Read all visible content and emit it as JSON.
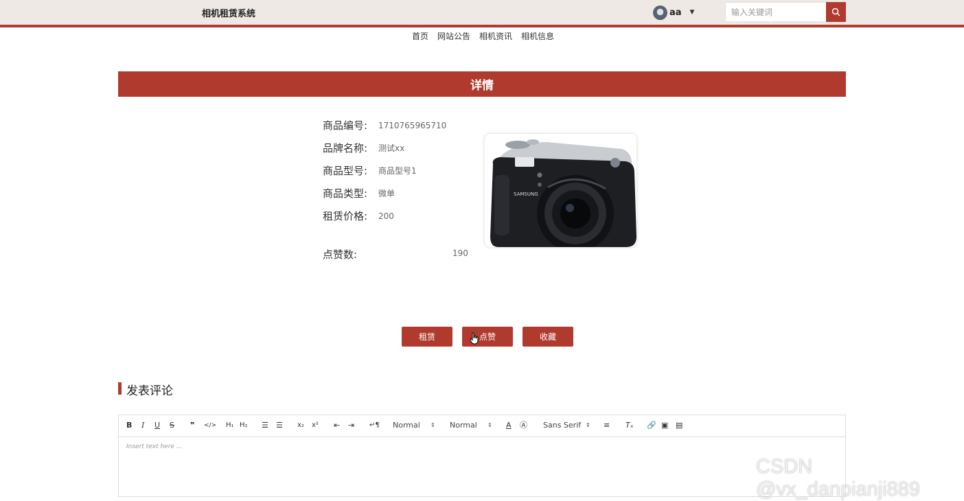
{
  "header": {
    "brand": "相机租赁系统",
    "username": "aa",
    "search_placeholder": "输入关键词"
  },
  "nav": [
    "首页",
    "网站公告",
    "相机资讯",
    "相机信息"
  ],
  "banner_title": "详情",
  "details": [
    {
      "label": "商品编号:",
      "value": "1710765965710"
    },
    {
      "label": "品牌名称:",
      "value": "测试xx"
    },
    {
      "label": "商品型号:",
      "value": "商品型号1"
    },
    {
      "label": "商品类型:",
      "value": "微单"
    },
    {
      "label": "租赁价格:",
      "value": "200"
    }
  ],
  "likes": {
    "label": "点赞数:",
    "value": "190"
  },
  "actions": {
    "rent": "租赁",
    "like": "点赞",
    "favorite": "收藏"
  },
  "comment": {
    "title": "发表评论",
    "placeholder": "Insert text here ...",
    "toolbar": {
      "size": "Normal",
      "header": "Normal",
      "font": "Sans Serif"
    }
  },
  "photo": {
    "brand_text": "SAMSUNG",
    "icon": "camera-photo"
  },
  "watermark": "CSDN @vx_danpianji889",
  "colors": {
    "accent": "#b13a2e",
    "topbar": "#efe9e6"
  }
}
